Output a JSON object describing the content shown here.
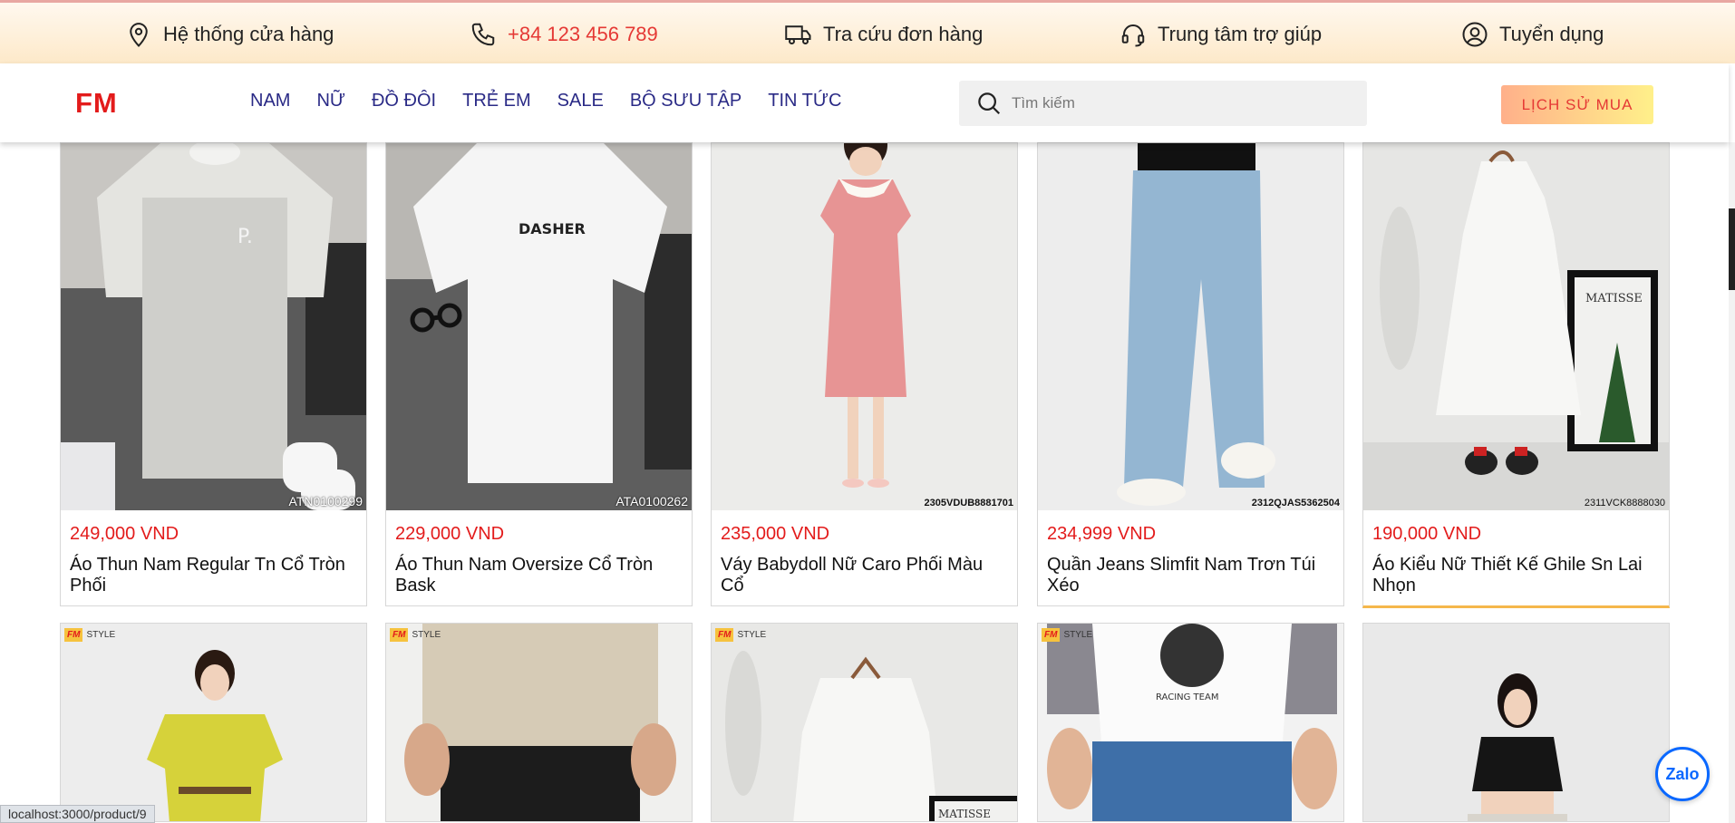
{
  "topbar": {
    "stores": "Hệ thống cửa hàng",
    "phone": "+84 123 456 789",
    "orders": "Tra cứu đơn hàng",
    "help": "Trung tâm trợ giúp",
    "careers": "Tuyển dụng"
  },
  "header": {
    "logo": "FM",
    "nav": [
      "NAM",
      "NỮ",
      "ĐỒ ĐÔI",
      "TRẺ EM",
      "SALE",
      "BỘ SƯU TẬP",
      "TIN TỨC"
    ],
    "search_placeholder": "Tìm kiếm",
    "history_button": "LỊCH SỬ MUA"
  },
  "products": [
    {
      "price": "249,000 VND",
      "name": "Áo Thun Nam Regular Tn Cổ Tròn Phối",
      "code": "ATN0100299"
    },
    {
      "price": "229,000 VND",
      "name": "Áo Thun Nam Oversize Cổ Tròn Bask",
      "code": "ATA0100262"
    },
    {
      "price": "235,000 VND",
      "name": "Váy Babydoll Nữ Caro Phối Màu Cổ",
      "code": "2305VDUB8881701"
    },
    {
      "price": "234,999 VND",
      "name": "Quần Jeans Slimfit Nam Trơn Túi Xéo",
      "code": "2312QJAS5362504"
    },
    {
      "price": "190,000 VND",
      "name": "Áo Kiểu Nữ Thiết Kế Ghile Sn Lai Nhọn",
      "code": "2311VCK8888030"
    }
  ],
  "tags": {
    "brand": "FM",
    "style": "STYLE"
  },
  "statusbar": "localhost:3000/product/9",
  "zalo": "Zalo",
  "images": {
    "print_text": "DASHER",
    "matisse": "MATISSE",
    "racing": "RACING TEAM"
  },
  "colors": {
    "accent": "#e31b1b",
    "nav": "#2a2a86",
    "topbar_gradient_start": "#fff8ef",
    "topbar_gradient_end": "#fde9c9"
  }
}
